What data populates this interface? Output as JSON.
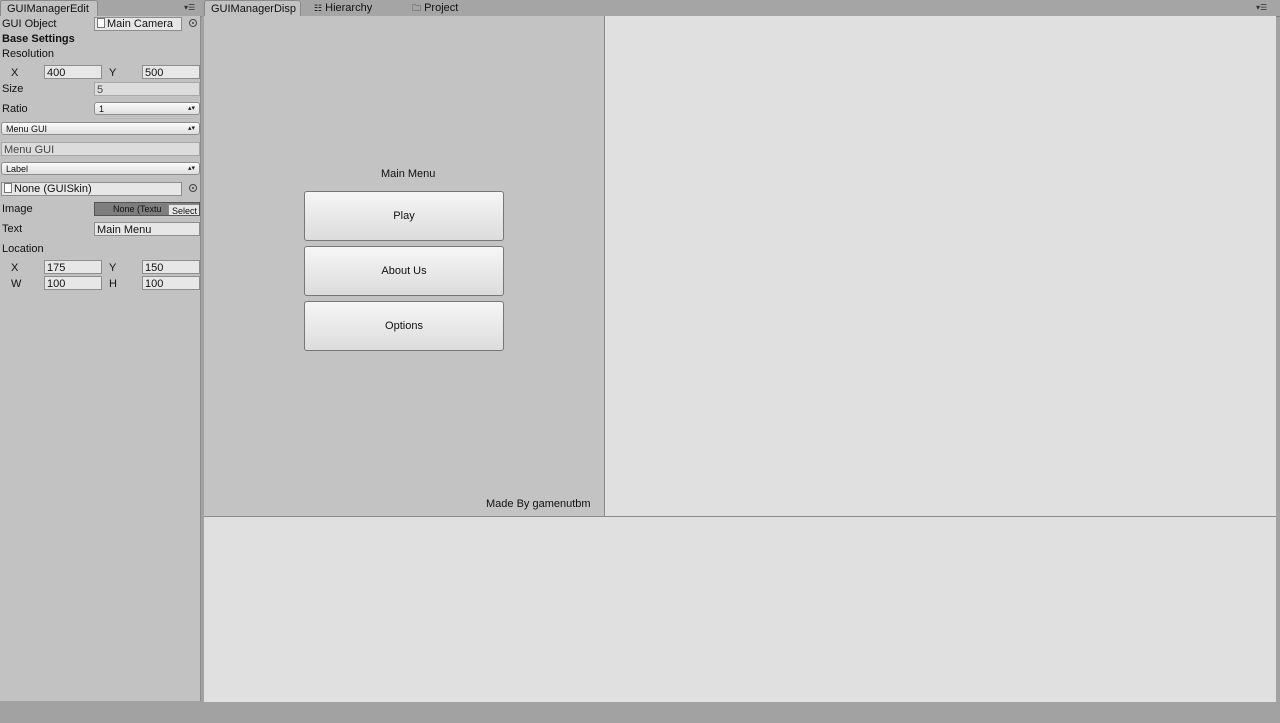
{
  "tabs_left": {
    "editor": "GUIManagerEdit"
  },
  "tabs_right": {
    "display": "GUIManagerDisp",
    "hierarchy": "Hierarchy",
    "project": "Project"
  },
  "inspector": {
    "gui_object_label": "GUI Object",
    "gui_object_value": "Main Camera",
    "base_settings": "Base Settings",
    "resolution_label": "Resolution",
    "res_x_label": "X",
    "res_x": "400",
    "res_y_label": "Y",
    "res_y": "500",
    "size_label": "Size",
    "size_value": "5",
    "ratio_label": "Ratio",
    "ratio_value": "1",
    "gui_group_select": "Menu GUI",
    "gui_group_name": "Menu GUI",
    "element_type_select": "Label",
    "skin_value": "None (GUISkin)",
    "image_label": "Image",
    "image_value": "None (Textu",
    "image_select": "Select",
    "text_label": "Text",
    "text_value": "Main Menu",
    "location_label": "Location",
    "loc_x_label": "X",
    "loc_x": "175",
    "loc_y_label": "Y",
    "loc_y": "150",
    "loc_w_label": "W",
    "loc_w": "100",
    "loc_h_label": "H",
    "loc_h": "100"
  },
  "display": {
    "title": "Main Menu",
    "buttons": [
      "Play",
      "About Us",
      "Options"
    ],
    "footer": "Made By gamenutbm"
  },
  "icons": [
    "tab-menu-icon",
    "hierarchy-icon",
    "folder-icon",
    "object-picker-icon",
    "dropdown-arrow-icon"
  ]
}
